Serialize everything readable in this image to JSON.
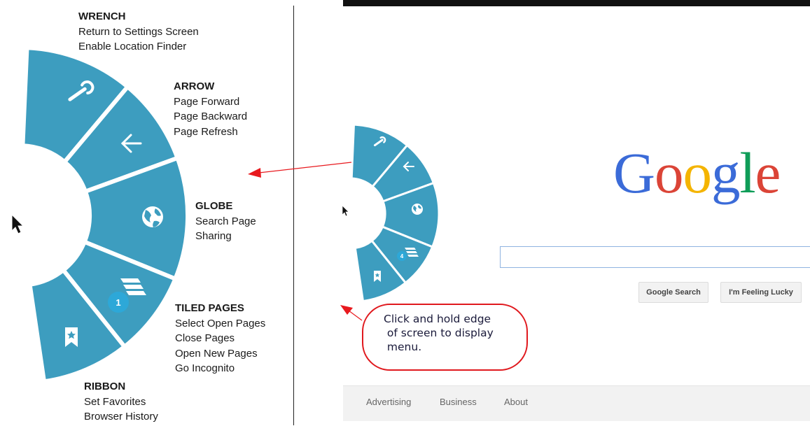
{
  "labels": {
    "wrench": {
      "heading": "WRENCH",
      "lines": [
        "Return to Settings Screen",
        "Enable Location Finder"
      ]
    },
    "arrow": {
      "heading": "ARROW",
      "lines": [
        "Page Forward",
        "Page Backward",
        "Page Refresh"
      ]
    },
    "globe": {
      "heading": "GLOBE",
      "lines": [
        "Search Page",
        "Sharing"
      ]
    },
    "tiled": {
      "heading": "TILED PAGES",
      "lines": [
        "Select Open Pages",
        "Close Pages",
        "Open New Pages",
        "Go Incognito"
      ]
    },
    "ribbon": {
      "heading": "RIBBON",
      "lines": [
        "Set Favorites",
        "Browser History"
      ]
    }
  },
  "big_menu": {
    "tab_count": "1"
  },
  "small_menu": {
    "tab_count": "4"
  },
  "google": {
    "logo": [
      "G",
      "o",
      "o",
      "g",
      "l",
      "e"
    ],
    "search_button": "Google Search",
    "lucky_button": "I'm Feeling Lucky"
  },
  "footer": {
    "links": [
      "Advertising",
      "Business",
      "About"
    ]
  },
  "callout": {
    "lines": [
      "Click and hold edge",
      " of screen to display",
      " menu."
    ]
  },
  "colors": {
    "menu": "#3d9dbf",
    "badge": "#2da8d8",
    "arrow": "#e8191e"
  }
}
